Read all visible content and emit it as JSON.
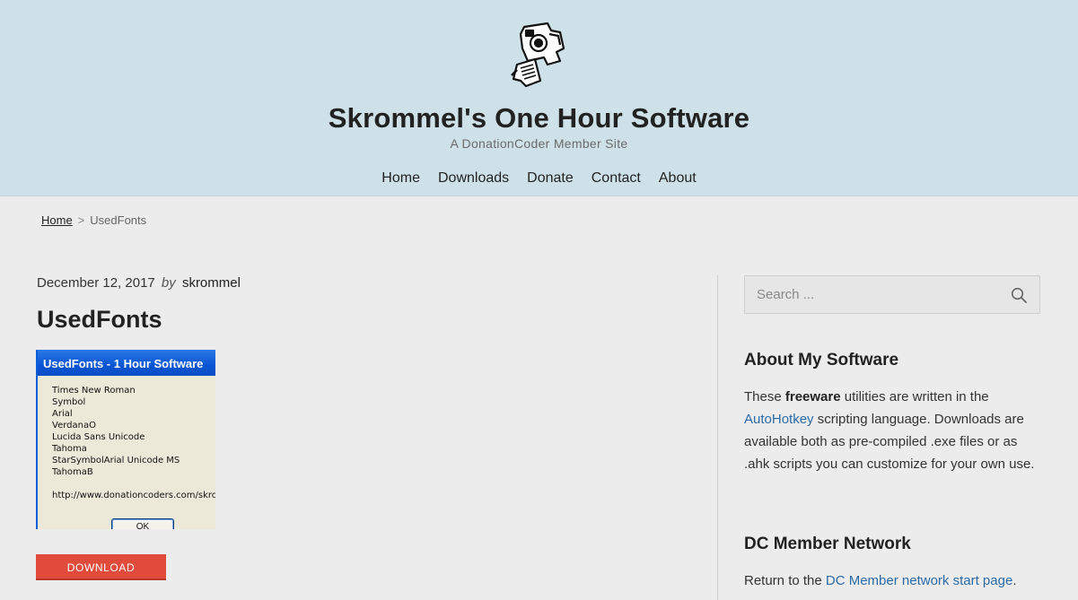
{
  "header": {
    "site_title": "Skrommel's One Hour Software",
    "tagline": "A DonationCoder Member Site",
    "nav": [
      "Home",
      "Downloads",
      "Donate",
      "Contact",
      "About"
    ]
  },
  "breadcrumb": {
    "home": "Home",
    "separator": ">",
    "current": "UsedFonts"
  },
  "post": {
    "date": "December 12, 2017",
    "by": "by",
    "author": "skrommel",
    "title": "UsedFonts",
    "screenshot": {
      "window_title": "UsedFonts - 1 Hour Software",
      "font_list": [
        "Times New Roman",
        "Symbol",
        "Arial",
        "VerdanaO",
        "Lucida Sans Unicode",
        "Tahoma",
        "StarSymbolArial Unicode MS",
        "TahomaB"
      ],
      "url": "http://www.donationcoders.com/skrommel",
      "ok_label": "OK"
    },
    "download_label": "DOWNLOAD"
  },
  "sidebar": {
    "search": {
      "placeholder": "Search ..."
    },
    "about": {
      "title": "About My Software",
      "text_1": "These ",
      "bold": "freeware",
      "text_2": " utilities are written in the ",
      "link": "AutoHotkey",
      "text_3": " scripting language. Downloads are available both as pre-compiled .exe files or as .ahk scripts you can customize for your own use."
    },
    "network": {
      "title": "DC Member Network",
      "text_1": "Return to the ",
      "link": "DC Member network start page",
      "text_2": "."
    }
  },
  "colors": {
    "header_bg": "#cfe1e8",
    "page_bg": "#ececec",
    "download_button": "#e04b3c",
    "link": "#2a6aa5"
  },
  "icons": [
    "camera-logo-icon",
    "search-icon"
  ]
}
